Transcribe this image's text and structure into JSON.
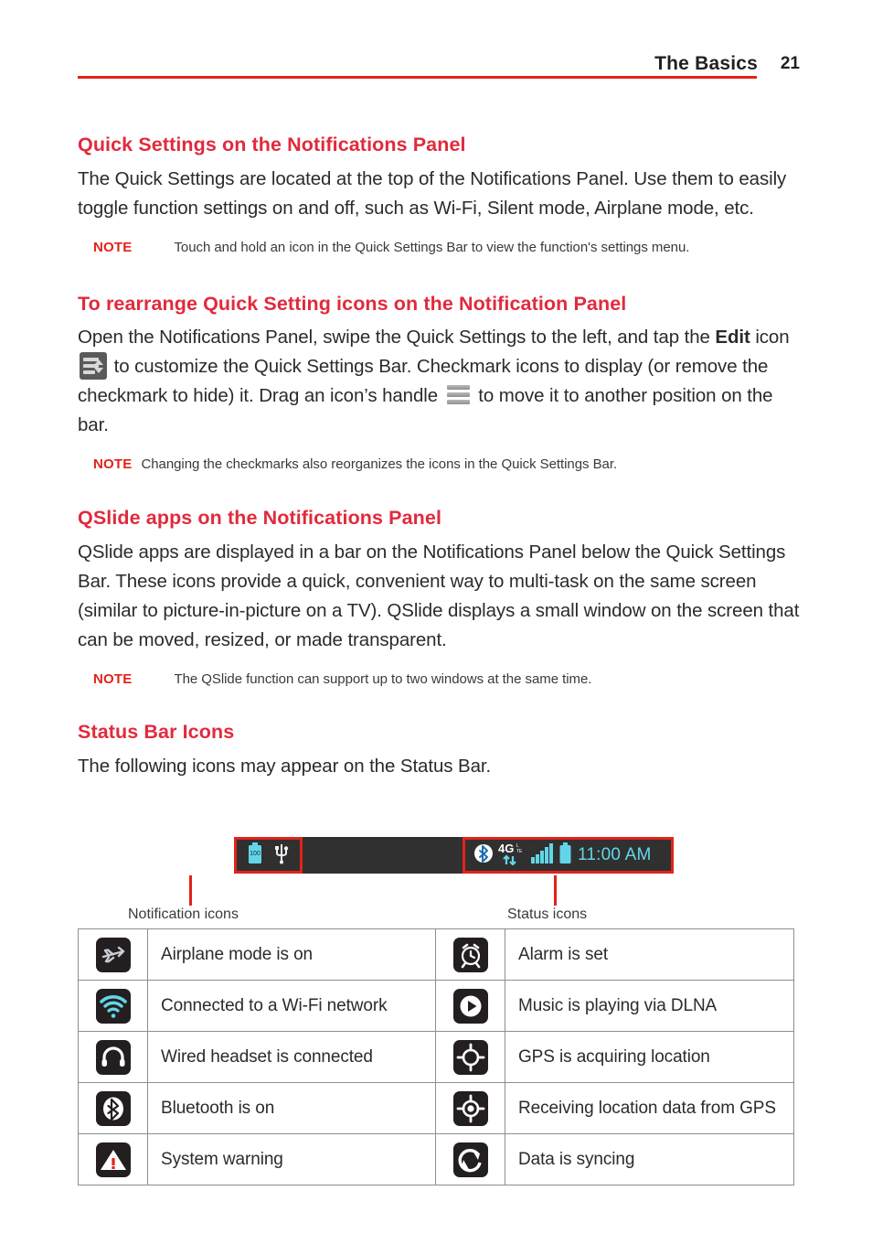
{
  "header": {
    "title": "The Basics",
    "page_number": "21"
  },
  "sections": [
    {
      "heading": "Quick Settings on the Notifications Panel",
      "body_prefix": "The Quick Settings are located at the top of the Notifications Panel. Use them to easily toggle function settings on and off, such as Wi-Fi, Silent mode, Airplane mode, etc.",
      "note_label": "NOTE",
      "note_text": "Touch and hold an icon in the Quick Settings Bar to view the function's settings menu."
    },
    {
      "heading": "To rearrange Quick Setting icons on the Notification Panel",
      "para_part1": "Open the Notifications Panel, swipe the Quick Settings to the left, and tap the ",
      "para_bold": "Edit",
      "para_part2": " icon ",
      "para_part3": " to customize the Quick Settings Bar. Checkmark icons to display (or remove the checkmark to hide) it. Drag an icon’s handle ",
      "para_part4": " to move it to another position on the bar.",
      "note_label": "NOTE",
      "note_text": "Changing the checkmarks also reorganizes the icons in the Quick Settings Bar."
    },
    {
      "heading": "QSlide apps on the Notifications Panel",
      "body": "QSlide apps are displayed in a bar on the Notifications Panel below the Quick Settings Bar. These icons provide a quick, convenient way to multi-task on the same screen (similar to picture-in-picture on a TV). QSlide displays a small window on the screen that can be moved, resized, or made transparent.",
      "note_label": "NOTE",
      "note_text": "The QSlide function can support up to two windows at the same time."
    },
    {
      "heading": "Status Bar Icons",
      "body": "The following icons may appear on the Status Bar."
    }
  ],
  "figure": {
    "status_time": "11:00 AM",
    "battery_level_text": "100",
    "network_label": "4G",
    "network_sub": "LTE",
    "caption_left": "Notification icons",
    "caption_right": "Status icons",
    "highlight_color": "#e2231a",
    "bar_background": "#303030",
    "accent_color": "#62d6e8",
    "left_icons": [
      "battery-charging-icon",
      "usb-icon"
    ],
    "right_icons": [
      "bluetooth-icon",
      "4g-lte-data-icon",
      "signal-bars-icon",
      "battery-icon"
    ]
  },
  "icon_table": {
    "rows": [
      {
        "left_icon": "airplane-icon",
        "left_label": "Airplane mode is on",
        "right_icon": "alarm-clock-icon",
        "right_label": "Alarm is set"
      },
      {
        "left_icon": "wifi-icon",
        "left_label": "Connected to a Wi-Fi network",
        "right_icon": "play-icon",
        "right_label": "Music is playing via DLNA"
      },
      {
        "left_icon": "headset-icon",
        "left_label": "Wired headset is connected",
        "right_icon": "gps-searching-icon",
        "right_label": "GPS is acquiring location"
      },
      {
        "left_icon": "bluetooth-icon",
        "left_label": "Bluetooth is on",
        "right_icon": "gps-fixed-icon",
        "right_label": "Receiving location data from GPS"
      },
      {
        "left_icon": "warning-icon",
        "left_label": "System warning",
        "right_icon": "sync-icon",
        "right_label": "Data is syncing"
      }
    ]
  },
  "colors": {
    "heading_red": "#e12a3c",
    "rule_red": "#e2231a",
    "body_text": "#2b2b2b",
    "icon_chip": "#231f20",
    "cyan": "#62d6e8"
  }
}
